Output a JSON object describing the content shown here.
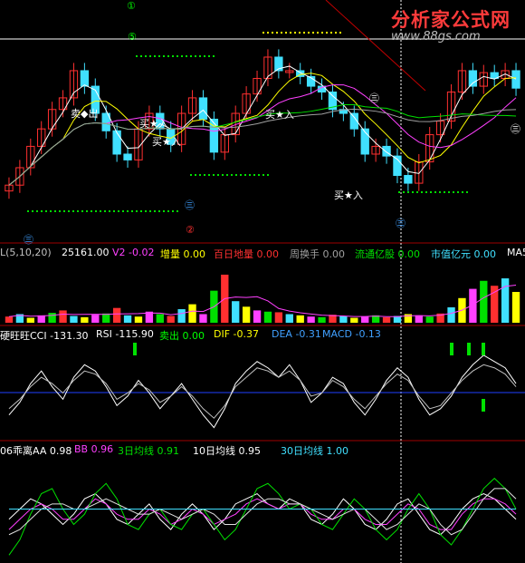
{
  "watermark": {
    "brand": "分析家公式网",
    "url": "www.88gs.com"
  },
  "main_panel": {
    "markers": {
      "circle_1": "①",
      "circle_5": "⑤",
      "circle_2": "②",
      "circle_3a": "㊂",
      "circle_3b": "㊂",
      "circle_3c": "㊂",
      "circle_3d": "㊂",
      "circle_3e": "㊂",
      "circle_paren": "(-)"
    },
    "signals": {
      "sell1": "卖◆出",
      "buy1": "买★入",
      "buy2": "买★入",
      "buy3": "买★入",
      "buy4": "买★入",
      "sell_short": "卖"
    }
  },
  "volume_panel": {
    "params": "L(5,10,20)",
    "vol_value": "25161.00",
    "v2": "V2 -0.02",
    "zengliang": "增量 0.00",
    "baiding": "百日地量 0.00",
    "zhouhuanshou": "周换手 0.00",
    "liutong": "流通亿股 0.00",
    "shizhi": "市值亿元 0.00",
    "ma5": "MA5"
  },
  "indicator_panel": {
    "cci": "硬旺旺CCI -131.30",
    "rsi": "RSI -115.90",
    "maichu": "卖出 0.00",
    "dif": "DIF -0.37",
    "dea": "DEA -0.31",
    "macd": "MACD -0.13"
  },
  "ma_panel": {
    "aa": "06乖离AA 0.98",
    "bb": "BB 0.96",
    "ma3": "3日均线 0.91",
    "ma10": "10日均线 0.95",
    "ma30": "30日均线 1.00"
  },
  "colors": {
    "up": "#ff3030",
    "down": "#40e0ff",
    "white": "#ffffff",
    "yellow": "#ffff00",
    "magenta": "#ff40ff",
    "green": "#00e000",
    "blue": "#2040ff",
    "gray": "#a0a0a0"
  },
  "chart_data": [
    {
      "type": "line",
      "title": "",
      "series": [
        {
          "name": "",
          "values": [
            27,
            36,
            47,
            56,
            66,
            72,
            86,
            78,
            64,
            55,
            43,
            40,
            56,
            64,
            56,
            48,
            64,
            72,
            61,
            44,
            53,
            64,
            74,
            82,
            93,
            86,
            86,
            83,
            78,
            75,
            66,
            64,
            56,
            43,
            47,
            42,
            32,
            28,
            39,
            53,
            60,
            75,
            86,
            78,
            85,
            82,
            86,
            77
          ]
        }
      ],
      "x": [
        0,
        1,
        2,
        3,
        4,
        5,
        6,
        7,
        8,
        9,
        10,
        11,
        12,
        13,
        14,
        15,
        16,
        17,
        18,
        19,
        20,
        21,
        22,
        23,
        24,
        25,
        26,
        27,
        28,
        29,
        30,
        31,
        32,
        33,
        34,
        35,
        36,
        37,
        38,
        39,
        40,
        41,
        42,
        43,
        44,
        45,
        46,
        47
      ],
      "ylim": [
        0,
        100
      ]
    },
    {
      "type": "bar",
      "title": "",
      "categories": [
        "1",
        "2",
        "3",
        "4",
        "5",
        "6",
        "7",
        "8",
        "9",
        "10",
        "11",
        "12",
        "13",
        "14",
        "15",
        "16",
        "17",
        "18",
        "19",
        "20",
        "21",
        "22",
        "23",
        "24",
        "25",
        "26",
        "27",
        "28",
        "29",
        "30",
        "31",
        "32",
        "33",
        "34",
        "35",
        "36",
        "37",
        "38",
        "39",
        "40",
        "41",
        "42",
        "43",
        "44",
        "45",
        "46",
        "47",
        "48"
      ],
      "values": [
        10,
        14,
        8,
        12,
        16,
        20,
        11,
        9,
        13,
        15,
        24,
        12,
        10,
        18,
        14,
        11,
        22,
        30,
        14,
        52,
        78,
        35,
        26,
        20,
        18,
        17,
        14,
        12,
        10,
        9,
        13,
        11,
        8,
        10,
        12,
        9,
        11,
        14,
        12,
        10,
        15,
        25,
        40,
        55,
        68,
        60,
        72,
        50
      ],
      "ylim": [
        0,
        100
      ]
    },
    {
      "type": "line",
      "title": "",
      "series": [
        {
          "name": "",
          "values": [
            -80,
            -40,
            20,
            60,
            10,
            -30,
            40,
            80,
            60,
            10,
            -50,
            -20,
            30,
            -10,
            -60,
            -20,
            20,
            -30,
            -80,
            -120,
            -60,
            20,
            60,
            90,
            70,
            40,
            80,
            30,
            -40,
            -10,
            40,
            20,
            -40,
            -80,
            -30,
            30,
            70,
            40,
            -30,
            -80,
            -60,
            -20,
            40,
            80,
            110,
            90,
            70,
            20
          ]
        },
        {
          "name": "",
          "values": [
            -60,
            -30,
            10,
            40,
            20,
            -10,
            30,
            60,
            50,
            20,
            -30,
            -10,
            20,
            0,
            -40,
            -20,
            10,
            -20,
            -60,
            -90,
            -50,
            10,
            40,
            70,
            60,
            40,
            60,
            30,
            -20,
            -10,
            30,
            10,
            -30,
            -60,
            -20,
            20,
            50,
            30,
            -20,
            -60,
            -50,
            -10,
            30,
            60,
            80,
            70,
            50,
            10
          ]
        }
      ],
      "x": [
        0,
        1,
        2,
        3,
        4,
        5,
        6,
        7,
        8,
        9,
        10,
        11,
        12,
        13,
        14,
        15,
        16,
        17,
        18,
        19,
        20,
        21,
        22,
        23,
        24,
        25,
        26,
        27,
        28,
        29,
        30,
        31,
        32,
        33,
        34,
        35,
        36,
        37,
        38,
        39,
        40,
        41,
        42,
        43,
        44,
        45,
        46,
        47
      ],
      "ylim": [
        -150,
        150
      ]
    },
    {
      "type": "line",
      "title": "",
      "series": [
        {
          "name": "AA",
          "values": [
            0.98,
            1.0,
            1.02,
            1.01,
            0.99,
            0.97,
            0.99,
            1.02,
            1.03,
            1.01,
            0.98,
            0.97,
            0.99,
            1.01,
            0.98,
            0.96,
            0.99,
            1.01,
            0.99,
            0.96,
            0.98,
            1.01,
            1.02,
            1.03,
            1.01,
            1.0,
            1.02,
            1.01,
            0.98,
            0.97,
            0.99,
            1.02,
            1.0,
            0.97,
            0.96,
            0.98,
            1.01,
            1.02,
            0.99,
            0.96,
            0.95,
            0.97,
            1.0,
            1.02,
            1.03,
            1.02,
            1.0,
            0.98
          ]
        },
        {
          "name": "BB",
          "values": [
            0.96,
            0.98,
            1.0,
            1.01,
            1.0,
            0.98,
            0.98,
            1.0,
            1.02,
            1.01,
            0.99,
            0.98,
            0.98,
            1.0,
            0.99,
            0.97,
            0.98,
            1.0,
            0.99,
            0.97,
            0.98,
            0.99,
            1.01,
            1.02,
            1.01,
            1.0,
            1.01,
            1.01,
            0.99,
            0.98,
            0.98,
            1.0,
            1.0,
            0.98,
            0.97,
            0.97,
            0.99,
            1.01,
            1.0,
            0.97,
            0.96,
            0.96,
            0.99,
            1.01,
            1.02,
            1.02,
            1.01,
            0.99
          ]
        },
        {
          "name": "3日均线",
          "values": [
            0.91,
            0.94,
            0.99,
            1.03,
            1.04,
            1.0,
            0.97,
            0.99,
            1.03,
            1.05,
            1.02,
            0.97,
            0.96,
            0.99,
            1.0,
            0.97,
            0.96,
            0.99,
            1.0,
            0.97,
            0.94,
            0.96,
            1.0,
            1.04,
            1.05,
            1.03,
            1.0,
            1.01,
            1.0,
            0.97,
            0.96,
            0.99,
            1.02,
            1.0,
            0.96,
            0.94,
            0.96,
            1.0,
            1.03,
            1.0,
            0.95,
            0.93,
            0.96,
            1.0,
            1.04,
            1.06,
            1.04,
            1.0
          ]
        },
        {
          "name": "10日均线",
          "values": [
            0.95,
            0.96,
            0.98,
            1.0,
            1.01,
            1.01,
            1.0,
            1.0,
            1.01,
            1.02,
            1.01,
            1.0,
            0.99,
            0.99,
            1.0,
            0.99,
            0.98,
            0.99,
            1.0,
            0.99,
            0.97,
            0.97,
            0.99,
            1.01,
            1.02,
            1.02,
            1.01,
            1.01,
            1.0,
            0.99,
            0.98,
            0.99,
            1.0,
            1.0,
            0.98,
            0.96,
            0.97,
            0.99,
            1.01,
            1.0,
            0.97,
            0.95,
            0.96,
            0.99,
            1.02,
            1.04,
            1.04,
            1.02
          ]
        },
        {
          "name": "30日均线",
          "values": [
            1.0,
            1.0,
            1.0,
            1.0,
            1.0,
            1.0,
            1.0,
            1.0,
            1.0,
            1.0,
            1.0,
            1.0,
            1.0,
            1.0,
            1.0,
            1.0,
            1.0,
            1.0,
            1.0,
            1.0,
            1.0,
            1.0,
            1.0,
            1.0,
            1.0,
            1.0,
            1.0,
            1.0,
            1.0,
            1.0,
            1.0,
            1.0,
            1.0,
            1.0,
            1.0,
            1.0,
            1.0,
            1.0,
            1.0,
            1.0,
            1.0,
            1.0,
            1.0,
            1.0,
            1.0,
            1.0,
            1.0,
            1.0
          ]
        }
      ],
      "x": [
        0,
        1,
        2,
        3,
        4,
        5,
        6,
        7,
        8,
        9,
        10,
        11,
        12,
        13,
        14,
        15,
        16,
        17,
        18,
        19,
        20,
        21,
        22,
        23,
        24,
        25,
        26,
        27,
        28,
        29,
        30,
        31,
        32,
        33,
        34,
        35,
        36,
        37,
        38,
        39,
        40,
        41,
        42,
        43,
        44,
        45,
        46,
        47
      ],
      "ylim": [
        0.9,
        1.1
      ]
    }
  ]
}
